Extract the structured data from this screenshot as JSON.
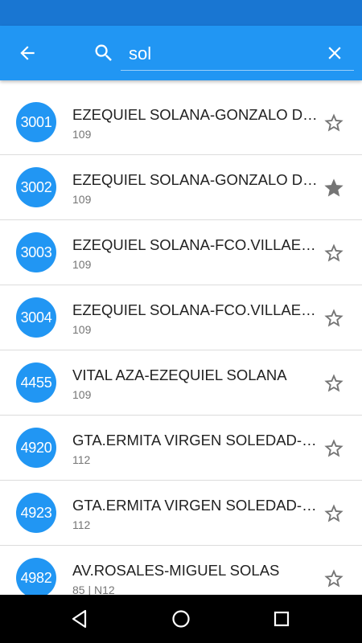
{
  "header": {
    "search_value": "sol"
  },
  "stops": [
    {
      "code": "3001",
      "name": "EZEQUIEL SOLANA-GONZALO DE CÓRDOBA",
      "lines": "109",
      "favorite": false
    },
    {
      "code": "3002",
      "name": "EZEQUIEL SOLANA-GONZALO DE CÓRDOBA",
      "lines": "109",
      "favorite": true
    },
    {
      "code": "3003",
      "name": "EZEQUIEL SOLANA-FCO.VILLAESPESA",
      "lines": "109",
      "favorite": false
    },
    {
      "code": "3004",
      "name": "EZEQUIEL SOLANA-FCO.VILLAESPESA",
      "lines": "109",
      "favorite": false
    },
    {
      "code": "4455",
      "name": "VITAL AZA-EZEQUIEL SOLANA",
      "lines": "109",
      "favorite": false
    },
    {
      "code": "4920",
      "name": "GTA.ERMITA VIRGEN SOLEDAD-SOLANA",
      "lines": "112",
      "favorite": false
    },
    {
      "code": "4923",
      "name": "GTA.ERMITA VIRGEN SOLEDAD-SOLANA",
      "lines": "112",
      "favorite": false
    },
    {
      "code": "4982",
      "name": "AV.ROSALES-MIGUEL SOLAS",
      "lines": "85 | N12",
      "favorite": false
    }
  ],
  "icons": {
    "back": "arrow-back-icon",
    "search": "search-icon",
    "clear": "close-icon",
    "favorite_off": "star-outline-icon",
    "favorite_on": "star-filled-icon",
    "nav_back": "triangle-back-icon",
    "nav_home": "circle-home-icon",
    "nav_recents": "square-recents-icon"
  },
  "colors": {
    "status_bar": "#1976d2",
    "app_bar": "#2196f3",
    "badge": "#2196f3",
    "star": "#757575"
  }
}
